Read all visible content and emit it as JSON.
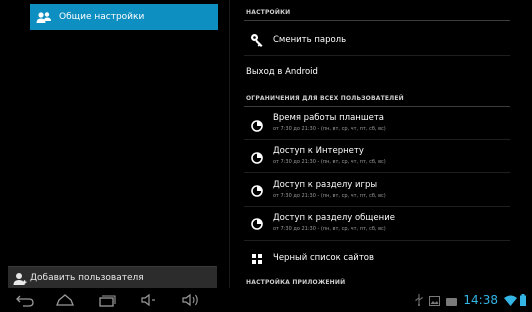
{
  "left": {
    "selected_item": "Общие настройки",
    "add_user": "Добавить пользователя"
  },
  "right": {
    "section_settings": "НАСТРОЙКИ",
    "change_password": "Сменить пароль",
    "exit_android": "Выход в Android",
    "section_restrictions": "ОГРАНИЧЕНИЯ ДЛЯ ВСЕХ ПОЛЬЗОВАТЕЛЕЙ",
    "restrictions": [
      {
        "title": "Время работы планшета",
        "subtitle": "от 7:30 до 21:30 - (пн, вт, ср, чт, пт, сб, вс)"
      },
      {
        "title": "Доступ к Интернету",
        "subtitle": "от 7:30 до 21:30 - (пн, вт, ср, чт, пт, сб, вс)"
      },
      {
        "title": "Доступ к разделу игры",
        "subtitle": "от 7:30 до 21:30 - (пн, вт, ср, чт, пт, сб, вс)"
      },
      {
        "title": "Доступ к разделу общение",
        "subtitle": "от 7:30 до 21:30 - (пн, вт, ср, чт, пт, сб, вс)"
      }
    ],
    "blacklist": "Черный список сайтов",
    "section_apps": "НАСТРОЙКА ПРИЛОЖЕНИЙ"
  },
  "status": {
    "time": "14:38",
    "accent_color": "#33b5e5",
    "selected_color": "#0e8fc2"
  },
  "icons": {
    "settings": "users-settings-icon",
    "add_user": "add-user-icon",
    "key": "key-icon",
    "clock": "clock-icon",
    "grid": "grid-icon",
    "back": "back-icon",
    "home": "home-icon",
    "recents": "recents-icon",
    "vol_down": "volume-down-icon",
    "vol_up": "volume-up-icon",
    "usb": "usb-icon",
    "image": "image-icon",
    "battery_status": "storage-icon",
    "wifi": "wifi-icon",
    "battery": "battery-icon"
  }
}
